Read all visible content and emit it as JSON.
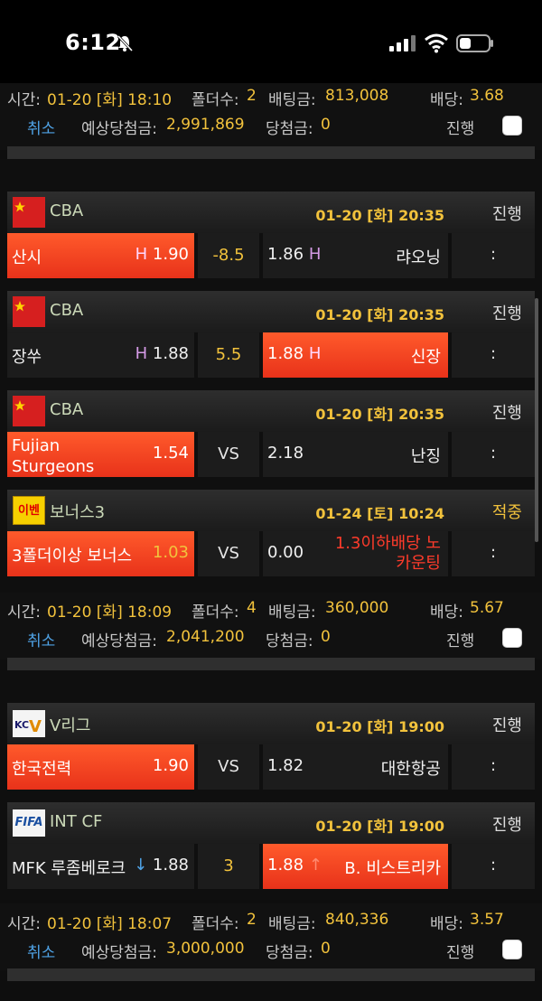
{
  "status_bar": {
    "time": "6:12"
  },
  "summary_labels": {
    "time": "시간:",
    "folders": "폴더수:",
    "bet": "배팅금:",
    "odds": "배당:",
    "cancel": "취소",
    "expected": "예상당첨금:",
    "won": "당첨금:"
  },
  "bets": [
    {
      "time": "01-20 [화] 18:10",
      "folders": "2",
      "bet_amount": "813,008",
      "odds": "3.68",
      "expected_win": "2,991,869",
      "win": "0",
      "status": "진행",
      "games": []
    },
    {
      "time": "01-20 [화] 18:09",
      "folders": "4",
      "bet_amount": "360,000",
      "odds": "5.67",
      "expected_win": "2,041,200",
      "win": "0",
      "status": "진행",
      "games": [
        {
          "league": "CBA",
          "datetime": "01-20 [화] 20:35",
          "status": "진행",
          "home": "산시",
          "home_marker": "H",
          "home_odds": "1.90",
          "line": "-8.5",
          "away_odds": "1.86",
          "away_marker": "H",
          "away": "랴오닝",
          "more": ":",
          "selected": "home"
        },
        {
          "league": "CBA",
          "datetime": "01-20 [화] 20:35",
          "status": "진행",
          "home": "장쑤",
          "home_marker": "H",
          "home_odds": "1.88",
          "line": "5.5",
          "away_odds": "1.88",
          "away_marker": "H",
          "away": "신장",
          "more": ":",
          "selected": "away"
        },
        {
          "league": "CBA",
          "datetime": "01-20 [화] 20:35",
          "status": "진행",
          "home": "Fujian Sturgeons",
          "home_odds": "1.54",
          "line": "VS",
          "away_odds": "2.18",
          "away": "난징",
          "more": ":",
          "selected": "home"
        },
        {
          "league": "보너스3",
          "badge": "이벤트",
          "datetime": "01-24 [토] 10:24",
          "status": "적중",
          "home": "3폴더이상 보너스",
          "home_odds": "1.03",
          "line": "VS",
          "away_odds": "0.00",
          "away": "1.3이하배당 노카운팅",
          "more": ":",
          "selected": "home"
        }
      ]
    },
    {
      "time": "01-20 [화] 18:07",
      "folders": "2",
      "bet_amount": "840,336",
      "odds": "3.57",
      "expected_win": "3,000,000",
      "win": "0",
      "status": "진행",
      "games": [
        {
          "league": "V리그",
          "logo": "KOVO",
          "datetime": "01-20 [화] 19:00",
          "status": "진행",
          "home": "한국전력",
          "home_odds": "1.90",
          "line": "VS",
          "away_odds": "1.82",
          "away": "대한항공",
          "more": ":",
          "selected": "home"
        },
        {
          "league": "INT CF",
          "logo": "FIFA",
          "datetime": "01-20 [화] 19:00",
          "status": "진행",
          "home": "MFK 루좀베로크",
          "home_arrow": "↓",
          "home_odds": "1.88",
          "line": "3",
          "away_odds": "1.88",
          "away_arrow": "↑",
          "away": "B. 비스트리카",
          "more": ":",
          "selected": "away"
        }
      ]
    }
  ],
  "colors": {
    "accent": "#f2c23c",
    "selected": "#f04a22",
    "link": "#4fa3e6",
    "hit": "#f2c23c"
  }
}
